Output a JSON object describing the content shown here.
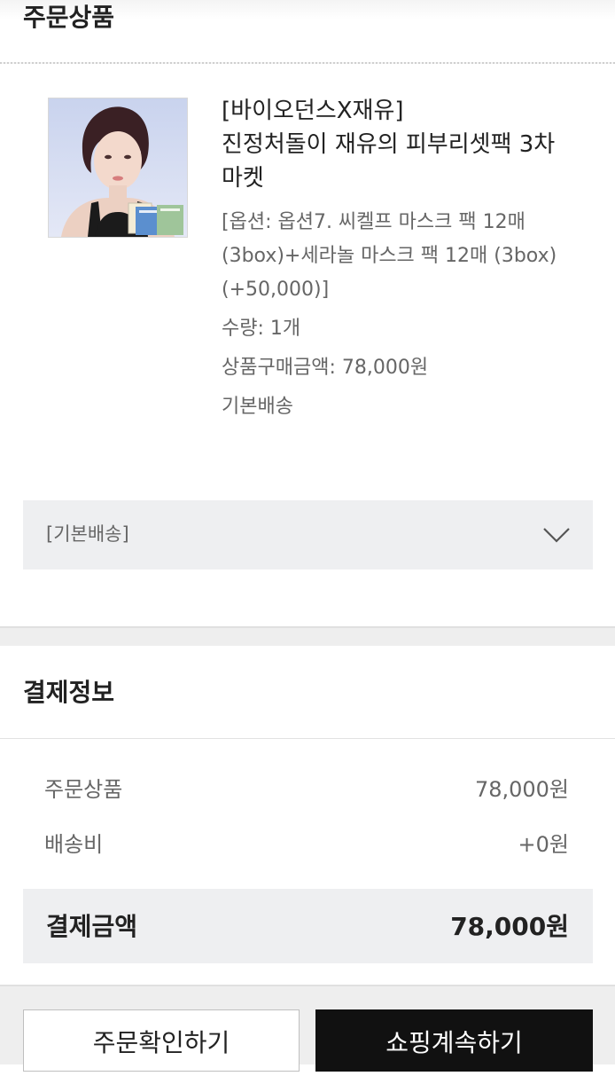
{
  "order": {
    "section_title": "주문상품",
    "product": {
      "name": "[바이오던스X재유]\n진정처돌이 재유의 피부리셋팩 3차\n마켓",
      "option": "[옵션: 옵션7. 씨켈프 마스크 팩 12매 (3box)+세라놀 마스크 팩 12매 (3box) (+50,000)]",
      "quantity": "수량: 1개",
      "price": "상품구매금액: 78,000원",
      "shipping_type": "기본배송"
    },
    "shipping_select": {
      "label": "[기본배송]",
      "icon": "chevron-down-icon"
    }
  },
  "payment": {
    "section_title": "결제정보",
    "rows": [
      {
        "label": "주문상품",
        "value": "78,000원"
      },
      {
        "label": "배송비",
        "value": "+0원"
      }
    ],
    "total": {
      "label": "결제금액",
      "value": "78,000원"
    }
  },
  "actions": {
    "confirm_label": "주문확인하기",
    "continue_label": "쇼핑계속하기"
  },
  "colors": {
    "accent_dark": "#111111",
    "panel_bg": "#eeeff1"
  }
}
